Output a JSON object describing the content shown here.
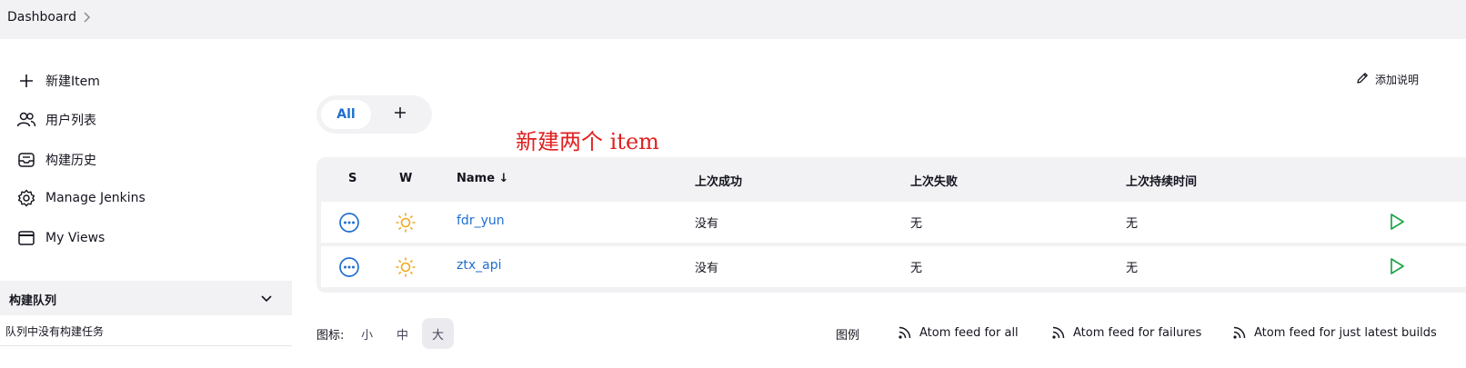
{
  "breadcrumb": {
    "root": "Dashboard"
  },
  "sidebar": {
    "items": [
      {
        "label": "新建Item",
        "icon": "plus-icon"
      },
      {
        "label": "用户列表",
        "icon": "people-icon"
      },
      {
        "label": "构建历史",
        "icon": "history-inbox-icon"
      },
      {
        "label": "Manage Jenkins",
        "icon": "gear-icon"
      },
      {
        "label": "My Views",
        "icon": "window-icon"
      }
    ]
  },
  "build_queue": {
    "title": "构建队列",
    "empty_text": "队列中没有构建任务"
  },
  "view_tabs": {
    "active": "All",
    "add_icon": "plus-icon"
  },
  "annotation": "新建两个 item",
  "edit_description": "添加说明",
  "table": {
    "headers": {
      "s": "S",
      "w": "W",
      "name": "Name ↓",
      "last_success": "上次成功",
      "last_failure": "上次失败",
      "last_duration": "上次持续时间"
    },
    "rows": [
      {
        "name": "fdr_yun",
        "last_success": "没有",
        "last_failure": "无",
        "last_duration": "无",
        "status_icon": "not-built-icon",
        "weather_icon": "sunny-icon"
      },
      {
        "name": "ztx_api",
        "last_success": "没有",
        "last_failure": "无",
        "last_duration": "无",
        "status_icon": "not-built-icon",
        "weather_icon": "sunny-icon"
      }
    ]
  },
  "footer": {
    "icon_label": "图标:",
    "sizes": [
      "小",
      "中",
      "大"
    ],
    "selected_size": "大",
    "legend": "图例",
    "feeds": [
      "Atom feed for all",
      "Atom feed for failures",
      "Atom feed for just latest builds"
    ]
  },
  "colors": {
    "link": "#1f6fd1",
    "annotation": "#e02020",
    "play": "#1ea446",
    "weather": "#f0a81c",
    "panel": "#f2f2f4"
  }
}
